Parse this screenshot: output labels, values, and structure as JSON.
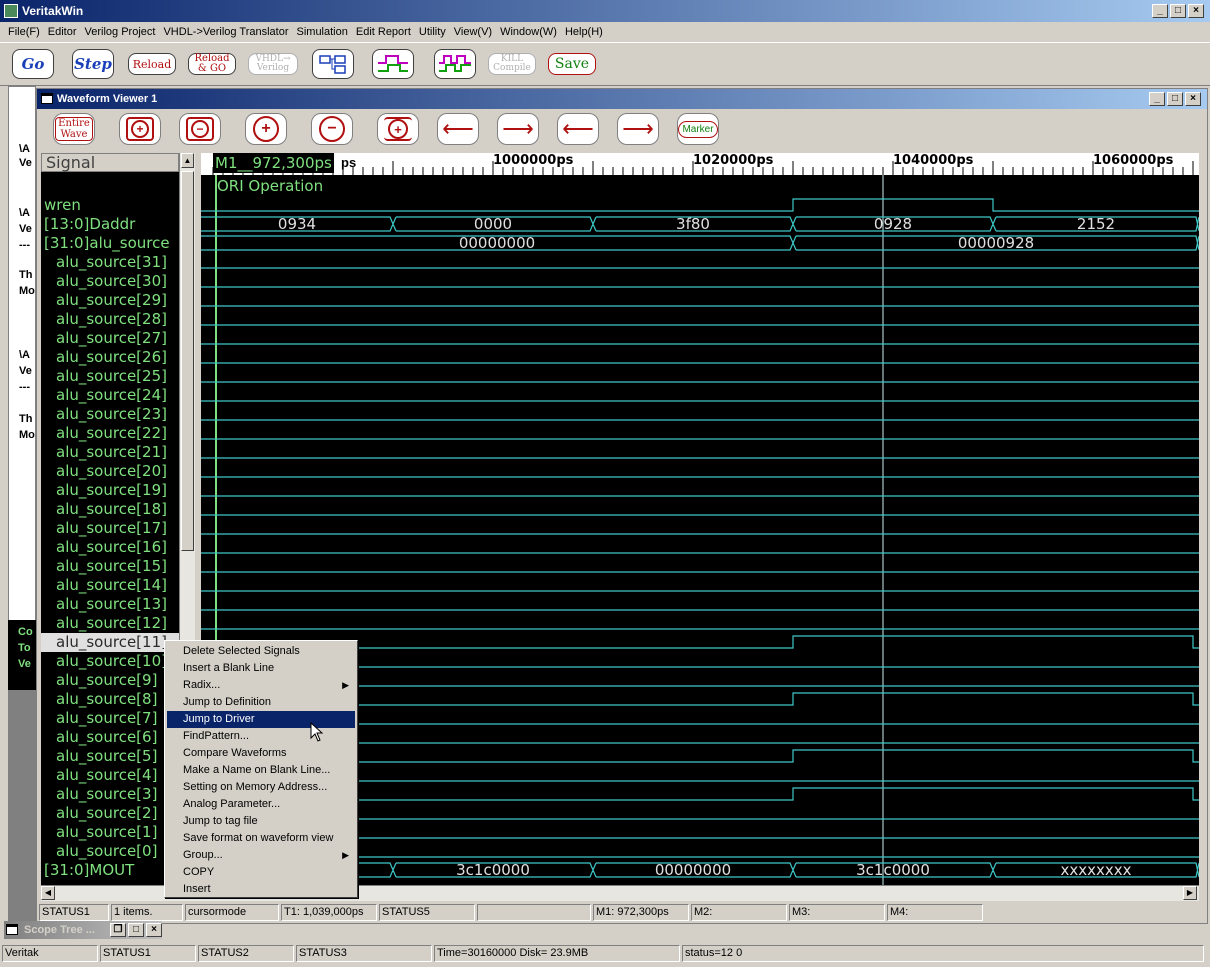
{
  "app": {
    "title": "VeritakWin",
    "menu": [
      "File(F)",
      "Editor",
      "Verilog Project",
      "VHDL->Verilog Translator",
      "Simulation",
      "Edit Report",
      "Utility",
      "View(V)",
      "Window(W)",
      "Help(H)"
    ],
    "toolbar": {
      "go": "Go",
      "step": "Step",
      "reload": "Reload",
      "reload_go_1": "Reload",
      "reload_go_2": "& GO",
      "vhdl_1": "VHDL→",
      "vhdl_2": "Verilog",
      "kill_1": "KILL",
      "kill_2": "Compile",
      "save": "Save"
    },
    "left_panel_texts": [
      "\\A",
      "Ve",
      "\\A",
      "Ve",
      "---",
      "Th",
      "Mo",
      "\\A",
      "Ve",
      "---",
      "Th",
      "Mo"
    ],
    "left_black_texts": [
      "Co",
      "To",
      "Ve"
    ],
    "status": [
      "Veritak",
      "STATUS1",
      "STATUS2",
      "STATUS3",
      "Time=30160000 Disk= 23.9MB",
      "status=12 0"
    ]
  },
  "viewer": {
    "title": "Waveform Viewer 1",
    "entire_wave_1": "Entire",
    "entire_wave_2": "Wave",
    "marker": "Marker",
    "signal_header": "Signal",
    "signals": [
      "wren",
      "[13:0]Daddr",
      "[31:0]alu_source",
      "alu_source[31]",
      "alu_source[30]",
      "alu_source[29]",
      "alu_source[28]",
      "alu_source[27]",
      "alu_source[26]",
      "alu_source[25]",
      "alu_source[24]",
      "alu_source[23]",
      "alu_source[22]",
      "alu_source[21]",
      "alu_source[20]",
      "alu_source[19]",
      "alu_source[18]",
      "alu_source[17]",
      "alu_source[16]",
      "alu_source[15]",
      "alu_source[14]",
      "alu_source[13]",
      "alu_source[12]",
      "alu_source[11]",
      "alu_source[10]",
      "alu_source[9]",
      "alu_source[8]",
      "alu_source[7]",
      "alu_source[6]",
      "alu_source[5]",
      "alu_source[4]",
      "alu_source[3]",
      "alu_source[2]",
      "alu_source[1]",
      "alu_source[0]",
      "[31:0]MOUT"
    ],
    "selected_signal": "alu_source[11]",
    "ruler": {
      "m1_label": "M1__972,300ps",
      "m1_suffix": "ps",
      "ticks": [
        "1000000ps",
        "1020000ps",
        "1040000ps",
        "1060000ps"
      ]
    },
    "group_label": "ORI Operation",
    "bus_values": {
      "daddr": [
        "0934",
        "0000",
        "3f80",
        "0928",
        "2152"
      ],
      "alu_source": [
        "00000000",
        "00000928"
      ],
      "mout": [
        "3c1c0000",
        "00000000",
        "3c1c0000",
        "xxxxxxxx"
      ]
    },
    "status": [
      "STATUS1",
      "1 items.",
      "cursormode",
      "T1: 1,039,000ps",
      "STATUS5",
      "",
      "M1: 972,300ps",
      "M2:",
      "M3:",
      "M4:"
    ]
  },
  "scope_tree": {
    "title": "Scope Tree ..."
  },
  "context_menu": {
    "items": [
      {
        "label": "Delete Selected Signals"
      },
      {
        "label": "Insert a Blank Line"
      },
      {
        "label": "Radix...",
        "submenu": true
      },
      {
        "label": "Jump to Definition"
      },
      {
        "label": "Jump to Driver",
        "highlighted": true
      },
      {
        "label": "FindPattern..."
      },
      {
        "label": "Compare Waveforms"
      },
      {
        "label": "Make a Name on Blank Line..."
      },
      {
        "label": "Setting on Memory Address..."
      },
      {
        "label": "Analog Parameter..."
      },
      {
        "label": "Jump to tag file"
      },
      {
        "label": "Save format on waveform view"
      },
      {
        "label": "Group...",
        "submenu": true
      },
      {
        "label": "COPY"
      },
      {
        "label": "Insert"
      }
    ]
  },
  "colors": {
    "signal_text": "#7fe07f",
    "waveform": "#3fc8c8",
    "wave_bg": "#000000",
    "title_bar": "#0a246a",
    "highlight": "#0a246a",
    "button_red": "#b01010",
    "button_blue": "#1a3fb8"
  }
}
